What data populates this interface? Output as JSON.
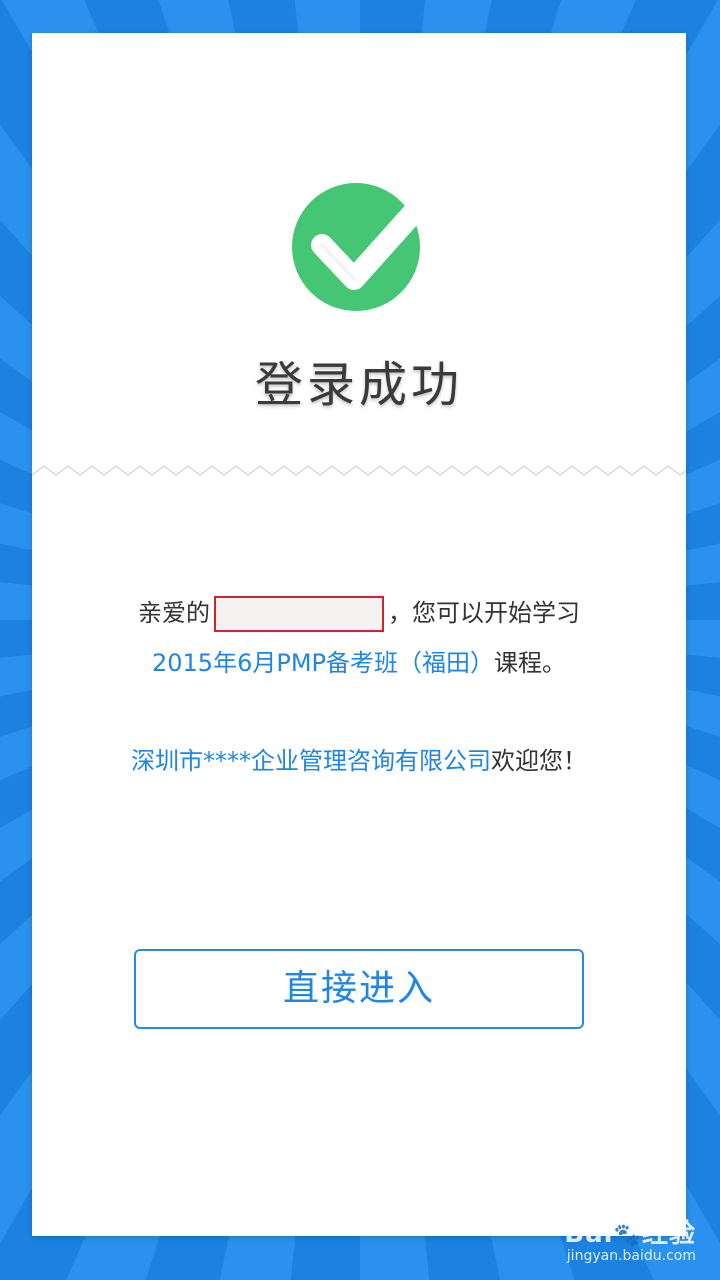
{
  "page": {
    "title": "登录成功"
  },
  "message": {
    "greeting_prefix": "亲爱的",
    "greeting_suffix": "，您可以开始学习",
    "course_name": "2015年6月PMP备考班（福田）",
    "course_suffix": "课程。",
    "company_name": "深圳市****企业管理咨询有限公司",
    "welcome_suffix": "欢迎您！"
  },
  "actions": {
    "enter_label": "直接进入"
  },
  "watermark": {
    "logo_text": "Bai",
    "logo_paw": "🐾",
    "logo_text2": "经验",
    "url": "jingyan.baidu.com"
  },
  "colors": {
    "background": "#1f88e6",
    "accent": "#1f86e3",
    "success": "#44c674",
    "redaction_border": "#d2222f"
  }
}
